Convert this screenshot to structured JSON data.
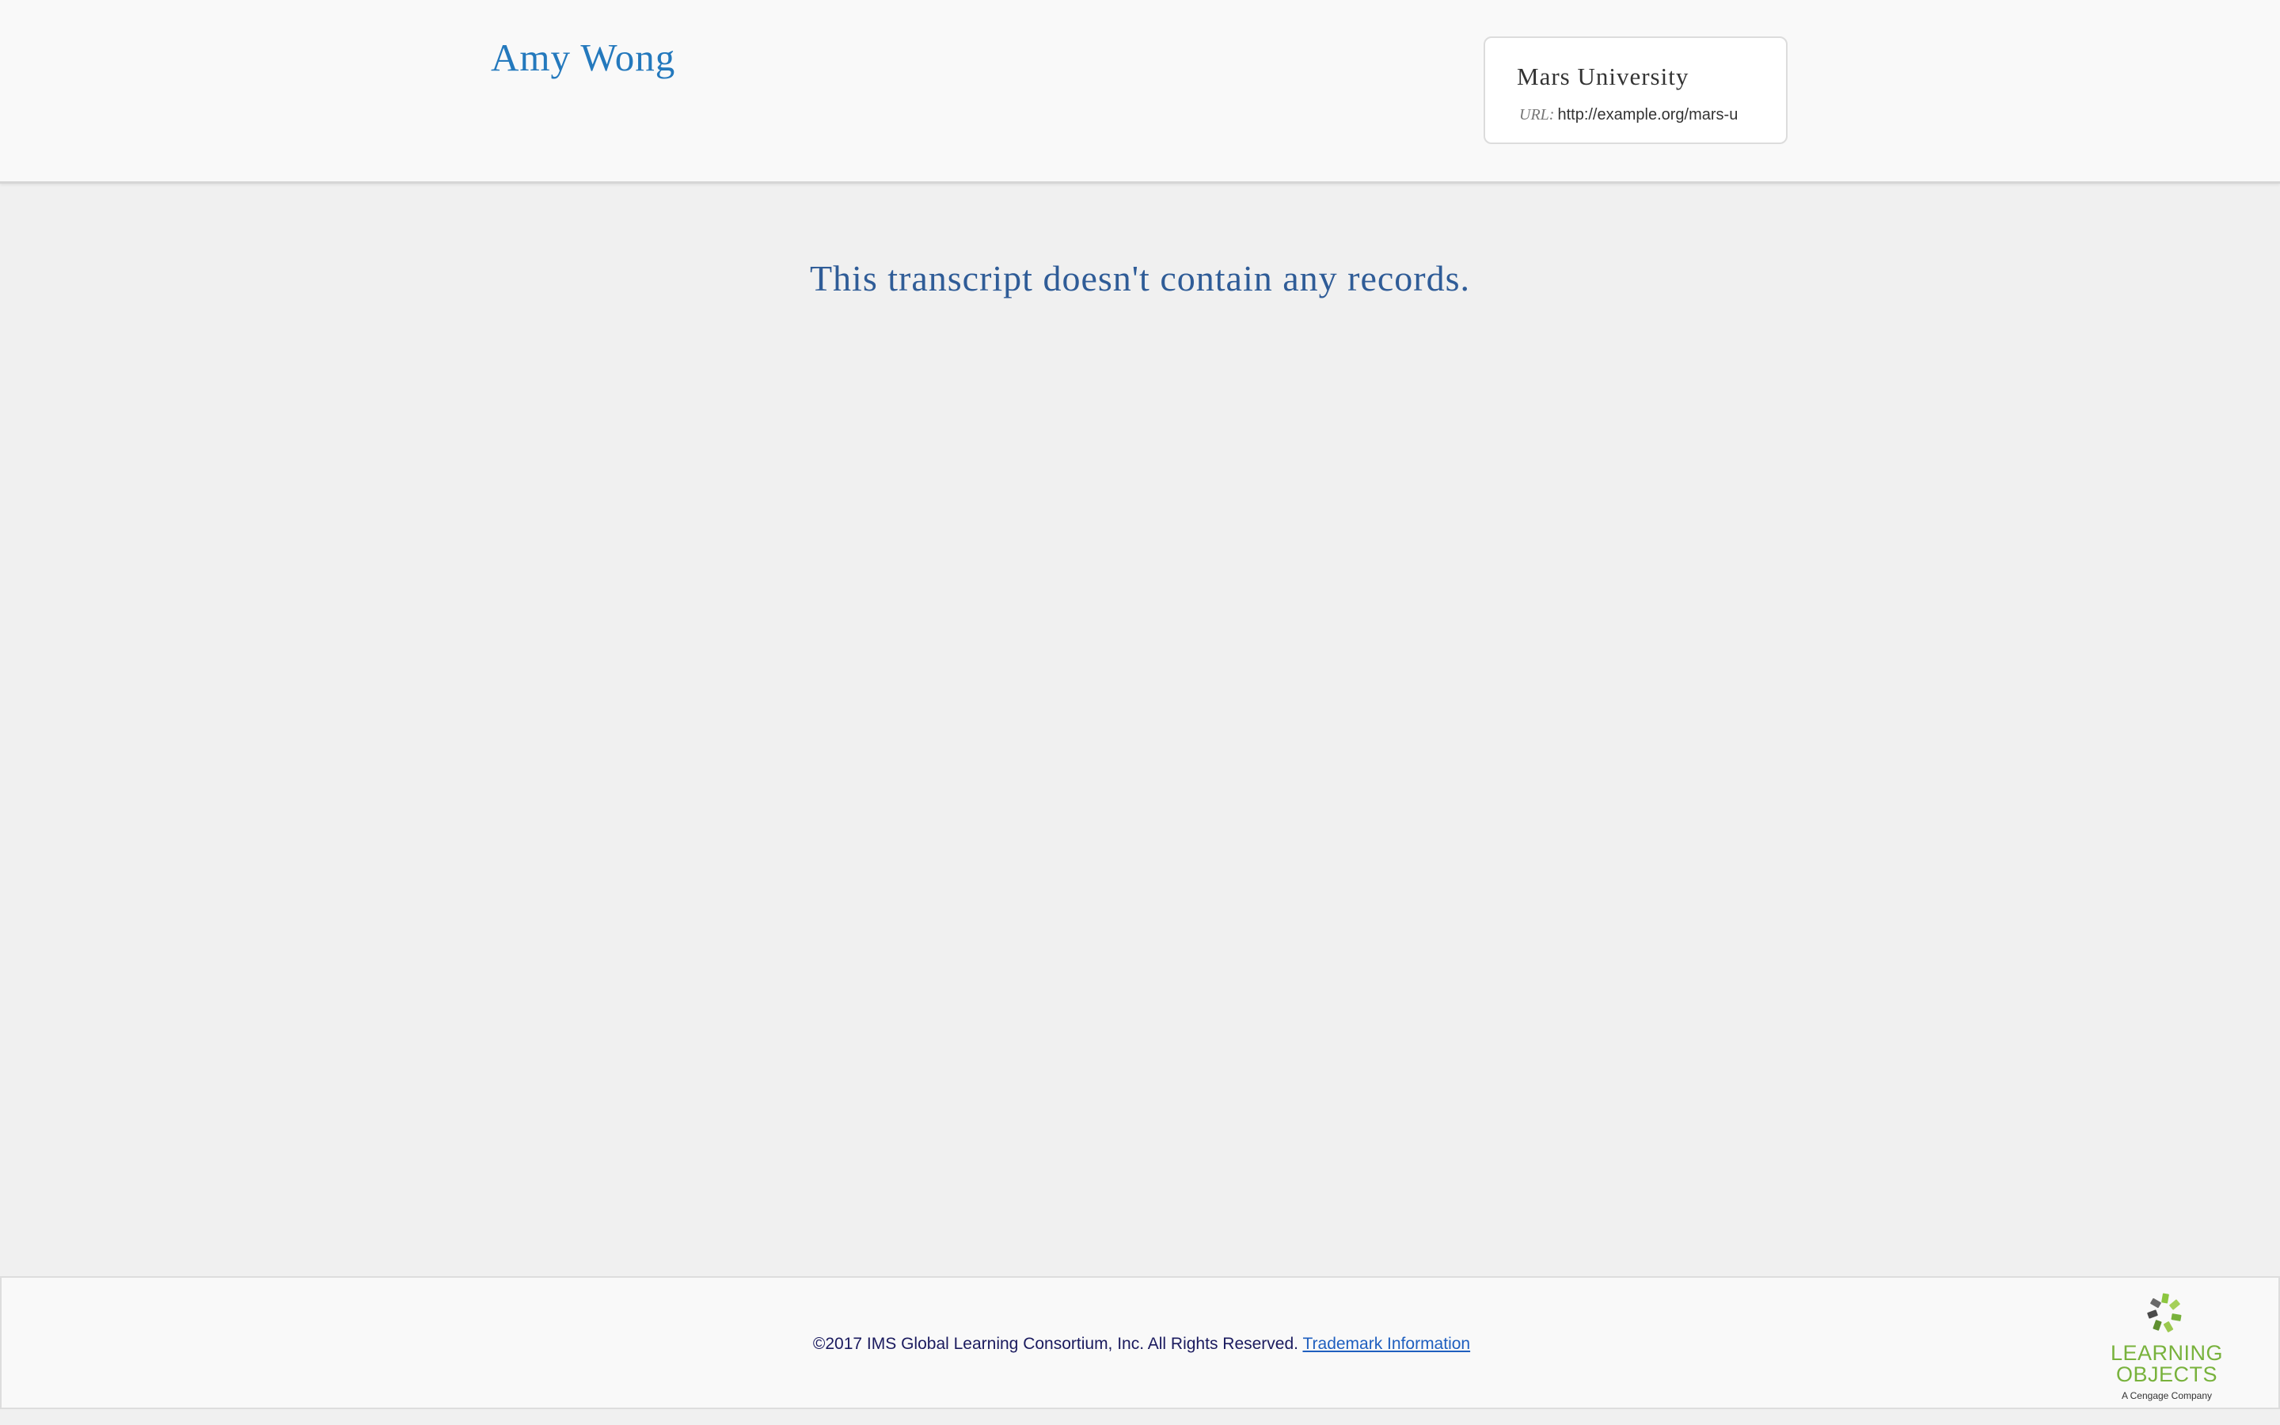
{
  "header": {
    "student_name": "Amy Wong",
    "issuer": {
      "name": "Mars University",
      "url_label": "URL:",
      "url": "http://example.org/mars-u"
    }
  },
  "main": {
    "empty_message": "This transcript doesn't contain any records."
  },
  "footer": {
    "copyright": "©2017 IMS Global Learning Consortium, Inc. All Rights Reserved.",
    "trademark_link": "Trademark Information",
    "logo": {
      "line1": "LEARNING",
      "line2": "OBJECTS",
      "sub": "A Cengage Company"
    }
  },
  "colors": {
    "accent": "#2479bd",
    "message": "#2f5c97",
    "logo_green": "#78b23c",
    "background": "#f0f0f0"
  }
}
